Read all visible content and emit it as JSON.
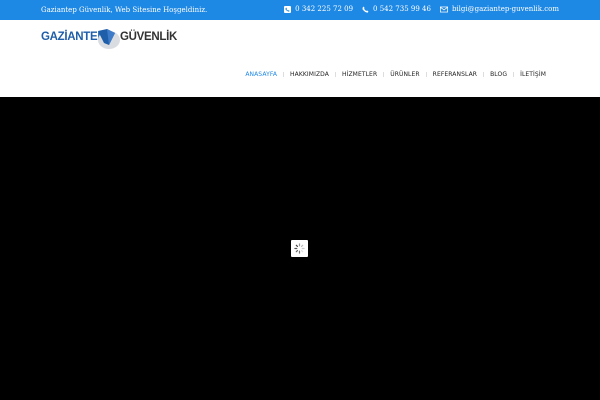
{
  "topbar": {
    "welcome": "Gaziantep Güvenlik, Web Sitesine Hoşgeldiniz.",
    "phone1": "0 342 225 72 09",
    "phone2": "0 542 735 99 46",
    "email": "bilgi@gaziantep-guvenlik.com",
    "icons": {
      "phone1": "phone-square-icon",
      "phone2": "phone-icon",
      "email": "envelope-icon"
    }
  },
  "logo": {
    "word1": "GAZİANTEP",
    "word2": "GÜVENLİK"
  },
  "nav": {
    "items": [
      {
        "label": "ANASAYFA",
        "active": true
      },
      {
        "label": "HAKKIMIZDA",
        "active": false
      },
      {
        "label": "HİZMETLER",
        "active": false
      },
      {
        "label": "ÜRÜNLER",
        "active": false
      },
      {
        "label": "REFERANSLAR",
        "active": false
      },
      {
        "label": "BLOG",
        "active": false
      },
      {
        "label": "İLETİŞİM",
        "active": false
      }
    ]
  },
  "colors": {
    "accent": "#1e88e5",
    "brand_blue": "#1f5ea8",
    "hero_bg": "#000000"
  },
  "hero": {
    "loader_icon": "spinner-icon"
  }
}
